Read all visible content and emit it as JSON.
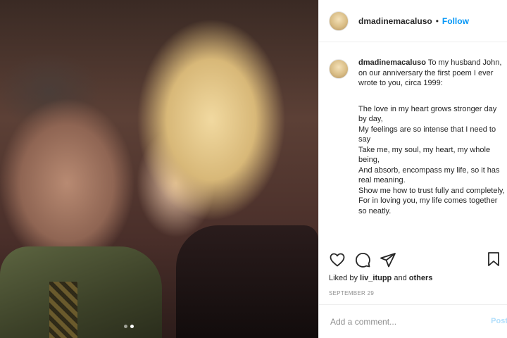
{
  "post": {
    "username": "dmadinemacaluso",
    "separator": "•",
    "follow_label": "Follow",
    "image_indicator": {
      "count": 2,
      "active": 1
    }
  },
  "caption": {
    "username": "dmadinemacaluso",
    "intro": "To my husband John, on our anniversary the first poem I ever wrote to you, circa 1999:",
    "poem_lines": [
      "The love in my heart grows stronger day by day,",
      "My feelings are so intense that I need to say",
      "Take me, my soul, my heart, my whole being,",
      "And absorb, encompass my life, so it has real meaning.",
      "Show me how to trust fully and completely,",
      "For in loving you, my life comes together so neatly."
    ]
  },
  "actions": {
    "like_icon": "heart-icon",
    "comment_icon": "comment-icon",
    "share_icon": "share-icon",
    "save_icon": "bookmark-icon"
  },
  "likes": {
    "prefix": "Liked by",
    "user": "liv_itupp",
    "connector": "and",
    "others": "others"
  },
  "date": "September 29",
  "comment": {
    "placeholder": "Add a comment...",
    "post_label": "Post"
  },
  "colors": {
    "link_blue": "#0095f6",
    "post_disabled": "#b2dffc",
    "muted": "#8e8e8e"
  }
}
